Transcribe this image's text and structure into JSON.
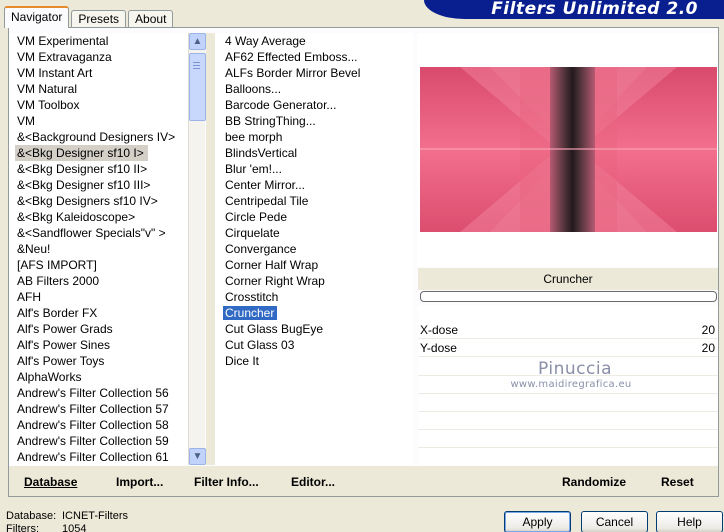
{
  "tabs": [
    {
      "label": "Navigator",
      "active": true
    },
    {
      "label": "Presets",
      "active": false
    },
    {
      "label": "About",
      "active": false
    }
  ],
  "banner": {
    "title": "Filters Unlimited 2.0"
  },
  "categories": [
    "VM Experimental",
    "VM Extravaganza",
    "VM Instant Art",
    "VM Natural",
    "VM Toolbox",
    "VM",
    "&<Background Designers IV>",
    "&<Bkg Designer sf10 I>",
    "&<Bkg Designer sf10 II>",
    "&<Bkg Designer sf10 III>",
    "&<Bkg Designers sf10 IV>",
    "&<Bkg Kaleidoscope>",
    "&<Sandflower Specials\"v\" >",
    "&Neu!",
    "[AFS IMPORT]",
    "AB Filters 2000",
    "AFH",
    "Alf's Border FX",
    "Alf's Power Grads",
    "Alf's Power Sines",
    "Alf's Power Toys",
    "AlphaWorks",
    "Andrew's Filter Collection 56",
    "Andrew's Filter Collection 57",
    "Andrew's Filter Collection 58",
    "Andrew's Filter Collection 59",
    "Andrew's Filter Collection 61"
  ],
  "selected_category_index": 7,
  "filters": [
    "4 Way Average",
    "AF62 Effected Emboss...",
    "ALFs Border Mirror Bevel",
    "Balloons...",
    "Barcode Generator...",
    "BB StringThing...",
    "bee morph",
    "BlindsVertical",
    "Blur 'em!...",
    "Center Mirror...",
    "Centripedal Tile",
    "Circle Pede",
    "Cirquelate",
    "Convergance",
    "Corner Half Wrap",
    "Corner Right Wrap",
    "Crosstitch",
    "Cruncher",
    "Cut Glass  BugEye",
    "Cut Glass 03",
    "Dice It"
  ],
  "selected_filter_index": 17,
  "preview": {
    "filter_name": "Cruncher",
    "accent_color": "#e8506f"
  },
  "params": [
    {
      "label": "X-dose",
      "value": "20"
    },
    {
      "label": "Y-dose",
      "value": "20"
    }
  ],
  "watermark": {
    "name": "Pinuccia",
    "url": "www.maidiregrafica.eu"
  },
  "actions": {
    "database": "Database",
    "import": "Import...",
    "filter_info": "Filter Info...",
    "editor": "Editor...",
    "randomize": "Randomize",
    "reset": "Reset"
  },
  "status": {
    "database_label": "Database:",
    "database_value": "ICNET-Filters",
    "filters_label": "Filters:",
    "filters_value": "1054"
  },
  "buttons": {
    "apply": "Apply",
    "cancel": "Cancel",
    "help": "Help"
  }
}
